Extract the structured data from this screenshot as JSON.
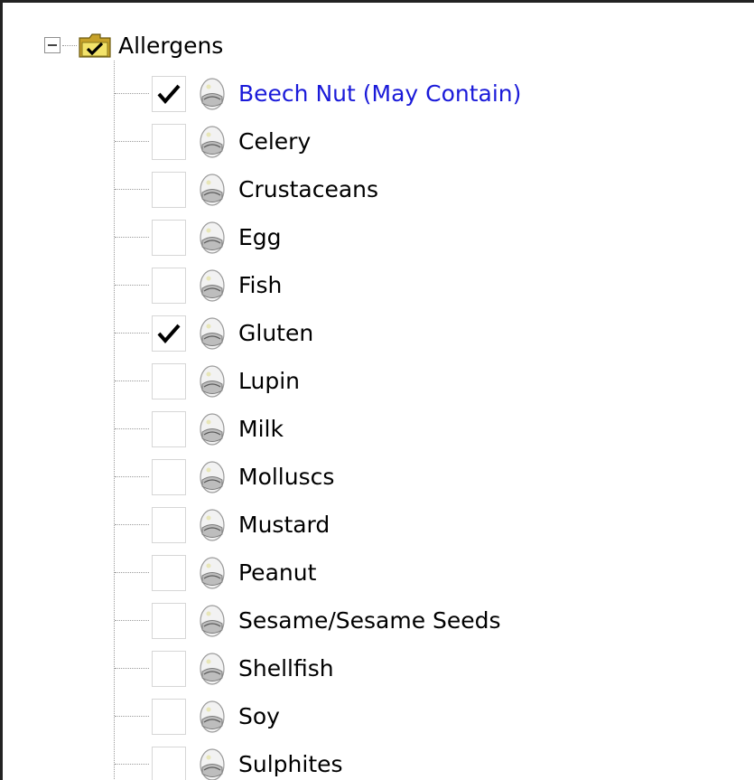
{
  "tree": {
    "root_label": "Allergens",
    "highlight_color": "#1a1ad9",
    "items": [
      {
        "label": "Beech Nut (May Contain)",
        "checked": true,
        "highlight": true
      },
      {
        "label": "Celery",
        "checked": false
      },
      {
        "label": "Crustaceans",
        "checked": false
      },
      {
        "label": "Egg",
        "checked": false
      },
      {
        "label": "Fish",
        "checked": false
      },
      {
        "label": "Gluten",
        "checked": true
      },
      {
        "label": "Lupin",
        "checked": false
      },
      {
        "label": "Milk",
        "checked": false
      },
      {
        "label": "Molluscs",
        "checked": false
      },
      {
        "label": "Mustard",
        "checked": false
      },
      {
        "label": "Peanut",
        "checked": false
      },
      {
        "label": "Sesame/Sesame Seeds",
        "checked": false
      },
      {
        "label": "Shellfish",
        "checked": false
      },
      {
        "label": "Soy",
        "checked": false
      },
      {
        "label": "Sulphites",
        "checked": false
      }
    ],
    "icons": {
      "expander": "collapse-minus-icon",
      "root": "checked-folder-icon",
      "node": "allergen-node-icon"
    }
  }
}
